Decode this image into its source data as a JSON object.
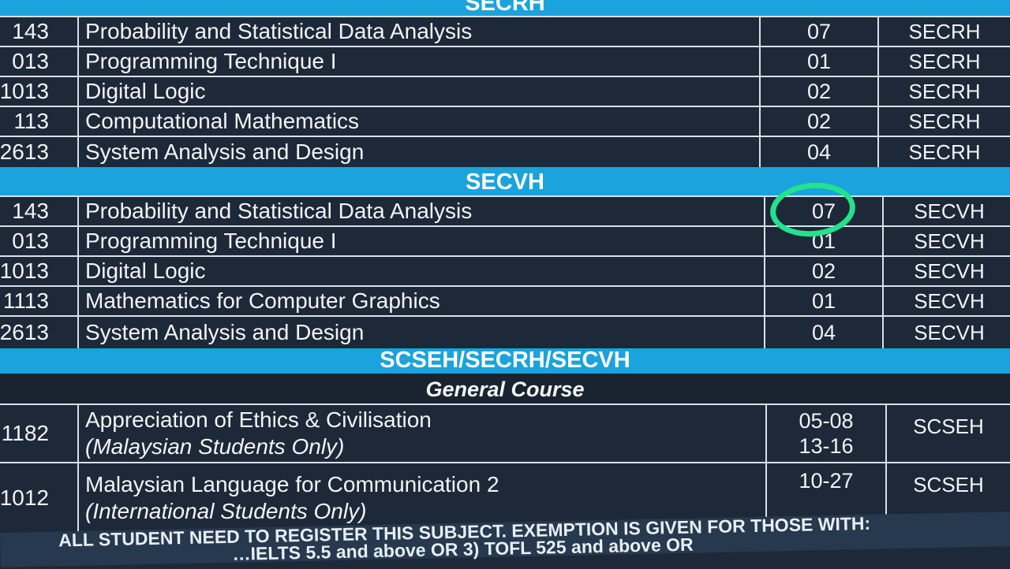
{
  "bands": {
    "secrh": "SECRH",
    "secvh": "SECVH",
    "combined": "SCSEH/SECRH/SECVH"
  },
  "secrh_rows": [
    {
      "code": "143",
      "name": "Probability and Statistical Data Analysis",
      "section": "07",
      "group": "SECRH"
    },
    {
      "code": "013",
      "name": "Programming Technique I",
      "section": "01",
      "group": "SECRH"
    },
    {
      "code": "1013",
      "name": "Digital Logic",
      "section": "02",
      "group": "SECRH"
    },
    {
      "code": "113",
      "name": "Computational Mathematics",
      "section": "02",
      "group": "SECRH"
    },
    {
      "code": "2613",
      "name": "System Analysis and Design",
      "section": "04",
      "group": "SECRH"
    }
  ],
  "secvh_rows": [
    {
      "code": "143",
      "name": "Probability and Statistical Data Analysis",
      "section": "07",
      "group": "SECVH"
    },
    {
      "code": "013",
      "name": "Programming Technique I",
      "section": "01",
      "group": "SECVH"
    },
    {
      "code": "1013",
      "name": "Digital Logic",
      "section": "02",
      "group": "SECVH"
    },
    {
      "code": "1113",
      "name": "Mathematics for Computer Graphics",
      "section": "01",
      "group": "SECVH"
    },
    {
      "code": "2613",
      "name": "System Analysis and Design",
      "section": "04",
      "group": "SECVH"
    }
  ],
  "general": {
    "heading": "General Course",
    "rows": [
      {
        "code": "1182",
        "name": "Appreciation of Ethics & Civilisation",
        "note": "(Malaysian Students Only)",
        "section_line1": "05-08",
        "section_line2": "13-16",
        "group": "SCSEH"
      },
      {
        "code": "1012",
        "name": "Malaysian Language for Communication 2",
        "note": "(International Students Only)",
        "section_line1": "10-27",
        "section_line2": "",
        "group": "SCSEH"
      }
    ]
  },
  "notice": {
    "line1": "ALL STUDENT NEED TO REGISTER THIS SUBJECT. EXEMPTION IS GIVEN FOR THOSE WITH:",
    "line2": "…IELTS 5.5 and above OR 3) TOFL 525 and above OR"
  },
  "colors": {
    "band": "#1aa3dc",
    "row_background": "#1d2838",
    "highlight_marker": "#22e28c"
  }
}
